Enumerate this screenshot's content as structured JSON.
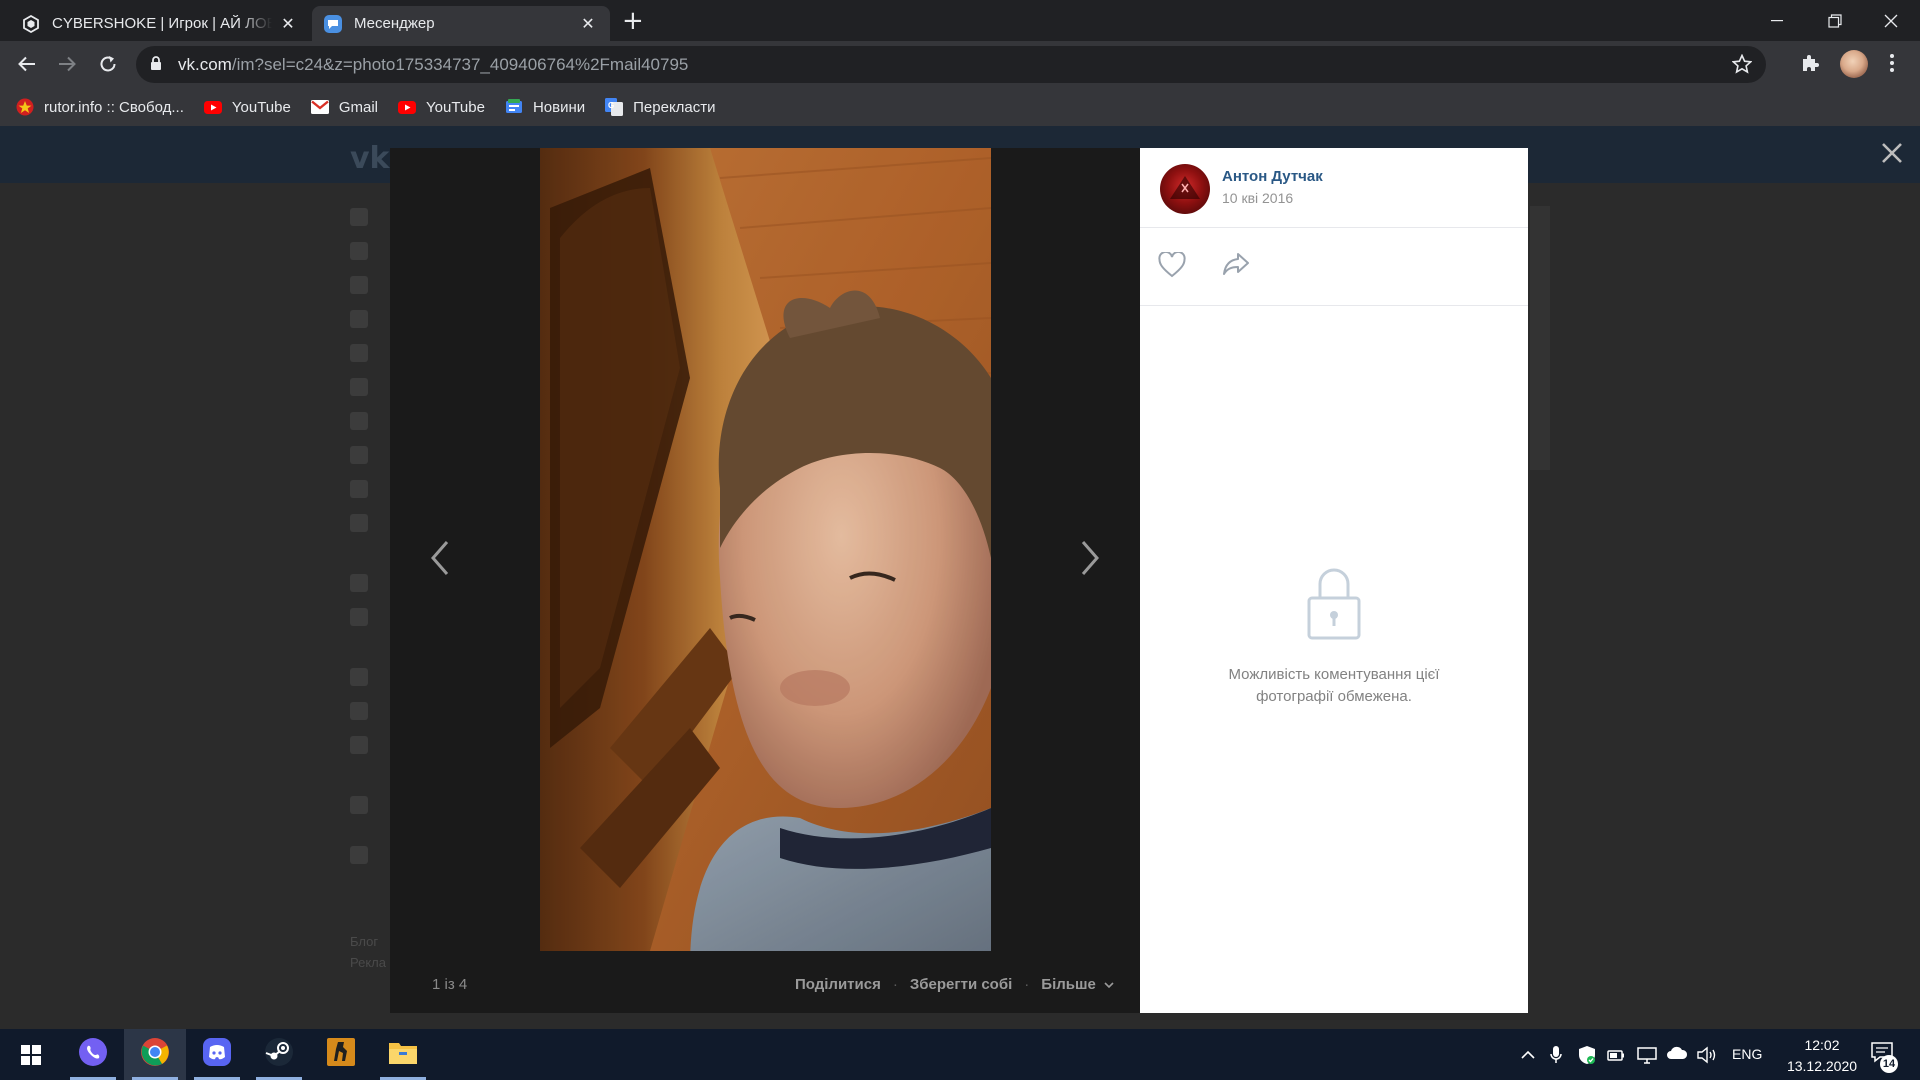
{
  "browser": {
    "tabs": [
      {
        "title": "CYBERSHOKE | Игрок | АЙ ЛОВИ",
        "close": "✕",
        "favicon": "cybershoke-icon"
      },
      {
        "title": "Месенджер",
        "close": "✕",
        "favicon": "vk-messenger-icon"
      }
    ],
    "new_tab": "+",
    "address": {
      "host": "vk.com",
      "path": "/im?sel=c24&z=photo175334737_409406764%2Fmail40795"
    },
    "bookmarks": [
      {
        "label": "rutor.info :: Свобод...",
        "icon": "rutor-icon"
      },
      {
        "label": "YouTube",
        "icon": "youtube-icon"
      },
      {
        "label": "Gmail",
        "icon": "gmail-icon"
      },
      {
        "label": "YouTube",
        "icon": "youtube-icon"
      },
      {
        "label": "Новини",
        "icon": "google-news-icon"
      },
      {
        "label": "Перекласти",
        "icon": "google-translate-icon"
      }
    ]
  },
  "vk_background": {
    "footer": [
      "Блог",
      "Рекла"
    ]
  },
  "viewer": {
    "counter": "1 із 4",
    "actions": {
      "share": "Поділитися",
      "save": "Зберегти собі",
      "more": "Більше"
    },
    "separator": "·"
  },
  "info": {
    "author_name": "Антон Дутчак",
    "date": "10 кві 2016",
    "comments_restricted": "Можливість коментування цієї фотографії обмежена."
  },
  "taskbar": {
    "apps": [
      "viber-icon",
      "chrome-icon",
      "discord-icon",
      "steam-icon",
      "csgo-icon",
      "file-explorer-icon"
    ],
    "language": "ENG",
    "time": "12:02",
    "date": "13.12.2020",
    "notifications": "14"
  },
  "colors": {
    "vk_link": "#2a5885",
    "chrome_dark": "#202124",
    "chrome_toolbar": "#35363a",
    "taskbar": "#101a2b"
  }
}
